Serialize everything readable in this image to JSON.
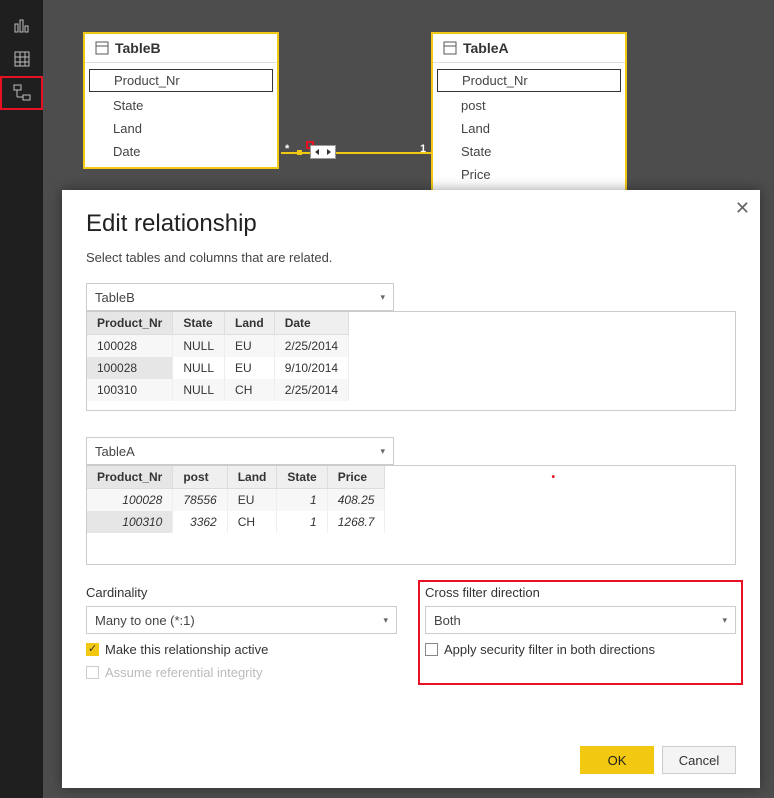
{
  "sidebar": {
    "views": [
      "report",
      "data",
      "model"
    ]
  },
  "canvas": {
    "tableB": {
      "name": "TableB",
      "fields": [
        "Product_Nr",
        "State",
        "Land",
        "Date"
      ],
      "selected": "Product_Nr"
    },
    "tableA": {
      "name": "TableA",
      "fields": [
        "Product_Nr",
        "post",
        "Land",
        "State",
        "Price"
      ],
      "selected": "Product_Nr"
    },
    "relationship": {
      "leftCard": "*",
      "rightCard": "1",
      "direction": "both"
    }
  },
  "dialog": {
    "title": "Edit relationship",
    "subtitle": "Select tables and columns that are related.",
    "fromTable": {
      "name": "TableB",
      "columns": [
        "Product_Nr",
        "State",
        "Land",
        "Date"
      ],
      "selectedColumn": "Product_Nr",
      "rows": [
        {
          "Product_Nr": "100028",
          "State": "NULL",
          "Land": "EU",
          "Date": "2/25/2014"
        },
        {
          "Product_Nr": "100028",
          "State": "NULL",
          "Land": "EU",
          "Date": "9/10/2014"
        },
        {
          "Product_Nr": "100310",
          "State": "NULL",
          "Land": "CH",
          "Date": "2/25/2014"
        }
      ]
    },
    "toTable": {
      "name": "TableA",
      "columns": [
        "Product_Nr",
        "post",
        "Land",
        "State",
        "Price"
      ],
      "selectedColumn": "Product_Nr",
      "rows": [
        {
          "Product_Nr": "100028",
          "post": "78556",
          "Land": "EU",
          "State": "1",
          "Price": "408.25"
        },
        {
          "Product_Nr": "100310",
          "post": "3362",
          "Land": "CH",
          "State": "1",
          "Price": "1268.7"
        }
      ]
    },
    "cardinality": {
      "label": "Cardinality",
      "value": "Many to one (*:1)"
    },
    "crossFilter": {
      "label": "Cross filter direction",
      "value": "Both"
    },
    "options": {
      "activeLabel": "Make this relationship active",
      "active": true,
      "securityLabel": "Apply security filter in both directions",
      "security": false,
      "referentialLabel": "Assume referential integrity",
      "referential": false
    },
    "buttons": {
      "ok": "OK",
      "cancel": "Cancel"
    }
  }
}
